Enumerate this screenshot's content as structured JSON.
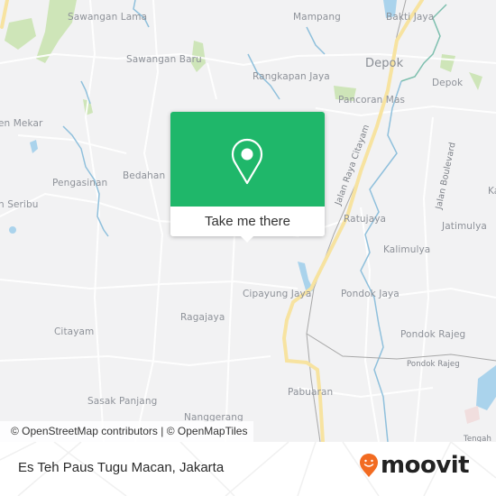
{
  "map": {
    "places": [
      {
        "id": "sawangan-lama",
        "label": "Sawangan Lama",
        "size": "normal"
      },
      {
        "id": "sawangan-baru",
        "label": "Sawangan Baru",
        "size": "normal"
      },
      {
        "id": "mampang",
        "label": "Mampang",
        "size": "normal"
      },
      {
        "id": "bakti-jaya",
        "label": "Bakti Jaya",
        "size": "normal"
      },
      {
        "id": "depok-city",
        "label": "Depok",
        "size": "big"
      },
      {
        "id": "depok-east",
        "label": "Depok",
        "size": "normal"
      },
      {
        "id": "rangkapan-jaya",
        "label": "Rangkapan Jaya",
        "size": "normal"
      },
      {
        "id": "pancoran-mas",
        "label": "Pancoran Mas",
        "size": "normal"
      },
      {
        "id": "pasir-putih-mekar",
        "label": "en Mekar",
        "size": "normal"
      },
      {
        "id": "bedahan",
        "label": "Bedahan",
        "size": "normal"
      },
      {
        "id": "pengasinan",
        "label": "Pengasinan",
        "size": "normal"
      },
      {
        "id": "seribu",
        "label": "n Seribu",
        "size": "normal"
      },
      {
        "id": "ratujaya",
        "label": "Ratujaya",
        "size": "normal"
      },
      {
        "id": "jatimulya",
        "label": "Jatimulya",
        "size": "normal"
      },
      {
        "id": "kalimulya",
        "label": "Kalimulya",
        "size": "normal"
      },
      {
        "id": "ka-edge",
        "label": "Ka",
        "size": "normal"
      },
      {
        "id": "cipayung-jaya",
        "label": "Cipayung Jaya",
        "size": "normal"
      },
      {
        "id": "pondok-jaya",
        "label": "Pondok Jaya",
        "size": "normal"
      },
      {
        "id": "ragajaya",
        "label": "Ragajaya",
        "size": "normal"
      },
      {
        "id": "citayam",
        "label": "Citayam",
        "size": "normal"
      },
      {
        "id": "pondok-rajeg",
        "label": "Pondok Rajeg",
        "size": "normal"
      },
      {
        "id": "pondok-rajeg-station",
        "label": "Pondok Rajeg",
        "size": "small"
      },
      {
        "id": "pabuaran",
        "label": "Pabuaran",
        "size": "normal"
      },
      {
        "id": "sasak-panjang",
        "label": "Sasak Panjang",
        "size": "normal"
      },
      {
        "id": "nanggerang",
        "label": "Nanggerang",
        "size": "normal"
      },
      {
        "id": "tengah",
        "label": "Tengah",
        "size": "small"
      }
    ],
    "roads": [
      {
        "id": "jalan-raya-citayam",
        "label": "Jalan Raya Citayam"
      },
      {
        "id": "jalan-boulevard",
        "label": "Jalan Boulevard"
      }
    ],
    "colors": {
      "background": "#f2f2f3",
      "water": "#aad3ec",
      "river": "#8fc0dc",
      "park": "#c8e3ae",
      "major_road": "#f7e3a0"
    }
  },
  "popup": {
    "icon": "map-pin-icon",
    "button_label": "Take me there",
    "color": "#1fb76a"
  },
  "attribution": "© OpenStreetMap contributors | © OpenMapTiles",
  "footer": {
    "title": "Es Teh Paus Tugu Macan, Jakarta",
    "brand": {
      "name": "moovit",
      "icon": "moovit-smiley-pin-icon",
      "color": "#f26b21"
    }
  }
}
